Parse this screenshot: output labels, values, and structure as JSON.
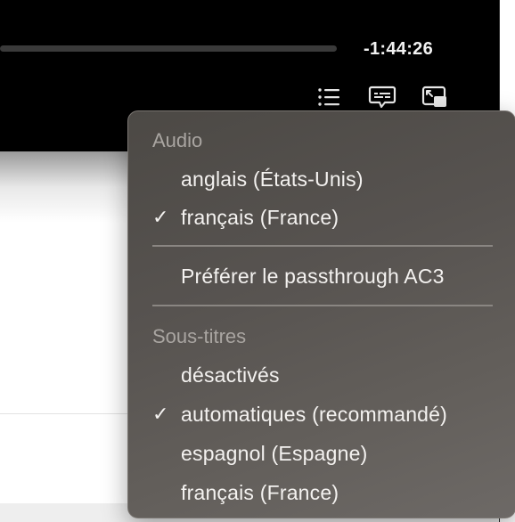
{
  "player": {
    "time_remaining": "-1:44:26",
    "controls": {
      "chapters": "list-icon",
      "subtitles": "subtitles-icon",
      "picture_in_picture": "picture-in-picture-icon"
    }
  },
  "menu": {
    "audio_header": "Audio",
    "audio_items": [
      {
        "label": "anglais (États-Unis)",
        "check": ""
      },
      {
        "label": "français (France)",
        "check": "✓"
      }
    ],
    "passthrough_label": "Préférer le passthrough AC3",
    "subtitles_header": "Sous-titres",
    "subtitle_items": [
      {
        "label": "désactivés",
        "check": ""
      },
      {
        "label": "automatiques (recommandé)",
        "check": "✓"
      },
      {
        "label": "espagnol (Espagne)",
        "check": ""
      },
      {
        "label": "français (France)",
        "check": ""
      }
    ]
  },
  "colors": {
    "menu_background": "#575350",
    "menu_text": "#f4f2f0",
    "menu_header_text": "#a9a5a1",
    "player_background": "#000000"
  }
}
